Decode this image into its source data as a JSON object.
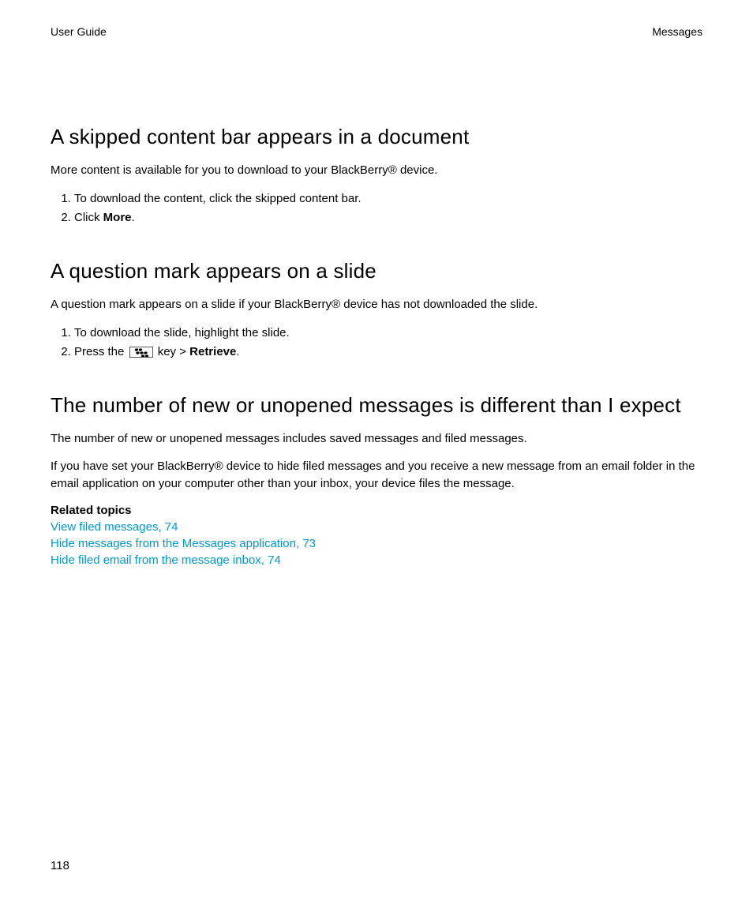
{
  "header": {
    "left": "User Guide",
    "right": "Messages"
  },
  "section1": {
    "heading": "A skipped content bar appears in a document",
    "intro": "More content is available for you to download to your BlackBerry® device.",
    "steps": {
      "s1": "To download the content, click the skipped content bar.",
      "s2_pre": "Click ",
      "s2_bold": "More",
      "s2_post": "."
    }
  },
  "section2": {
    "heading": "A question mark appears on a slide",
    "intro": "A question mark appears on a slide if your BlackBerry® device has not downloaded the slide.",
    "steps": {
      "s1": "To download the slide, highlight the slide.",
      "s2_pre": "Press the ",
      "s2_mid": " key > ",
      "s2_bold": "Retrieve",
      "s2_post": "."
    }
  },
  "section3": {
    "heading": "The number of new or unopened messages is different than I expect",
    "p1": "The number of new or unopened messages includes saved messages and filed messages.",
    "p2": "If you have set your BlackBerry® device to hide filed messages and you receive a new message from an email folder in the email application on your computer other than your inbox, your device files the message.",
    "related_heading": "Related topics",
    "links": {
      "l1": "View filed messages, 74",
      "l2": "Hide messages from the Messages application, 73",
      "l3": "Hide filed email from the message inbox, 74"
    }
  },
  "page_number": "118"
}
